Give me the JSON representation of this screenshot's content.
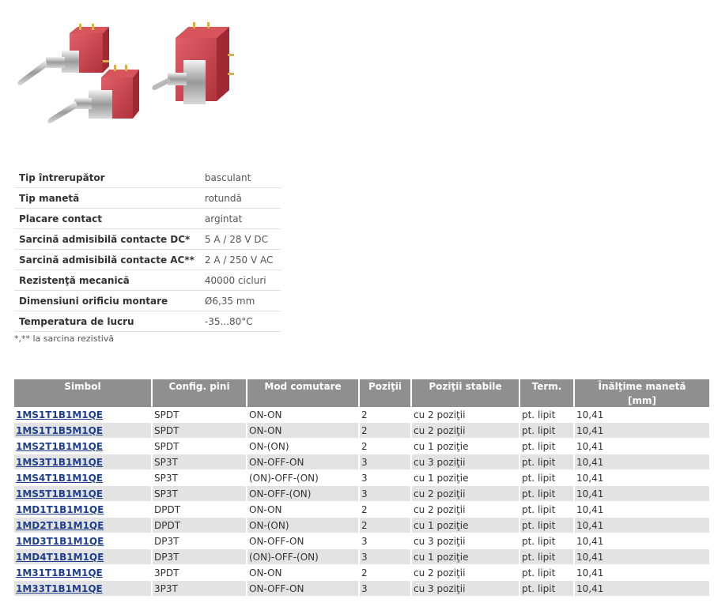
{
  "specs": [
    {
      "label": "Tip întrerupător",
      "value": "basculant"
    },
    {
      "label": "Tip manetă",
      "value": "rotundă"
    },
    {
      "label": "Placare contact",
      "value": "argintat"
    },
    {
      "label": "Sarcină admisibilă contacte DC*",
      "value": "5 A / 28 V DC"
    },
    {
      "label": "Sarcină admisibilă contacte AC**",
      "value": "2 A / 250 V AC"
    },
    {
      "label": "Rezistenţă mecanică",
      "value": "40000 cicluri"
    },
    {
      "label": "Dimensiuni orificiu montare",
      "value": "Ø6,35 mm"
    },
    {
      "label": "Temperatura de lucru",
      "value": "-35...80°C"
    }
  ],
  "note": "*,** la sarcina rezistivă",
  "table": {
    "headers": [
      "Simbol",
      "Config. pini",
      "Mod comutare",
      "Poziţii",
      "Poziţii stabile",
      "Term.",
      "Înălţime manetă"
    ],
    "subheader_unit": "[mm]",
    "rows": [
      {
        "symbol": "1MS1T1B1M1QE",
        "config": "SPDT",
        "mode": "ON-ON",
        "positions": "2",
        "stable": "cu 2 poziţii",
        "term": "pt. lipit",
        "height": "10,41"
      },
      {
        "symbol": "1MS1T1B5M1QE",
        "config": "SPDT",
        "mode": "ON-ON",
        "positions": "2",
        "stable": "cu 2 poziţii",
        "term": "pt. lipit",
        "height": "10,41"
      },
      {
        "symbol": "1MS2T1B1M1QE",
        "config": "SPDT",
        "mode": "ON-(ON)",
        "positions": "2",
        "stable": "cu 1 poziţie",
        "term": "pt. lipit",
        "height": "10,41"
      },
      {
        "symbol": "1MS3T1B1M1QE",
        "config": "SP3T",
        "mode": "ON-OFF-ON",
        "positions": "3",
        "stable": "cu 3 poziţii",
        "term": "pt. lipit",
        "height": "10,41"
      },
      {
        "symbol": "1MS4T1B1M1QE",
        "config": "SP3T",
        "mode": "(ON)-OFF-(ON)",
        "positions": "3",
        "stable": "cu 1 poziţie",
        "term": "pt. lipit",
        "height": "10,41"
      },
      {
        "symbol": "1MS5T1B1M1QE",
        "config": "SP3T",
        "mode": "ON-OFF-(ON)",
        "positions": "3",
        "stable": "cu 2 poziţii",
        "term": "pt. lipit",
        "height": "10,41"
      },
      {
        "symbol": "1MD1T1B1M1QE",
        "config": "DPDT",
        "mode": "ON-ON",
        "positions": "2",
        "stable": "cu 2 poziţii",
        "term": "pt. lipit",
        "height": "10,41"
      },
      {
        "symbol": "1MD2T1B1M1QE",
        "config": "DPDT",
        "mode": "ON-(ON)",
        "positions": "2",
        "stable": "cu 1 poziţie",
        "term": "pt. lipit",
        "height": "10,41"
      },
      {
        "symbol": "1MD3T1B1M1QE",
        "config": "DP3T",
        "mode": "ON-OFF-ON",
        "positions": "3",
        "stable": "cu 3 poziţii",
        "term": "pt. lipit",
        "height": "10,41"
      },
      {
        "symbol": "1MD4T1B1M1QE",
        "config": "DP3T",
        "mode": "(ON)-OFF-(ON)",
        "positions": "3",
        "stable": "cu 1 poziţie",
        "term": "pt. lipit",
        "height": "10,41"
      },
      {
        "symbol": "1M31T1B1M1QE",
        "config": "3PDT",
        "mode": "ON-ON",
        "positions": "2",
        "stable": "cu 2 poziţii",
        "term": "pt. lipit",
        "height": "10,41"
      },
      {
        "symbol": "1M33T1B1M1QE",
        "config": "3P3T",
        "mode": "ON-OFF-ON",
        "positions": "3",
        "stable": "cu 3 poziţii",
        "term": "pt. lipit",
        "height": "10,41"
      }
    ]
  },
  "colors": {
    "header_bg": "#8f8f8f",
    "row_alt": "#e3e3e3",
    "link": "#1f3f8f",
    "switch_red": "#c8424a"
  }
}
